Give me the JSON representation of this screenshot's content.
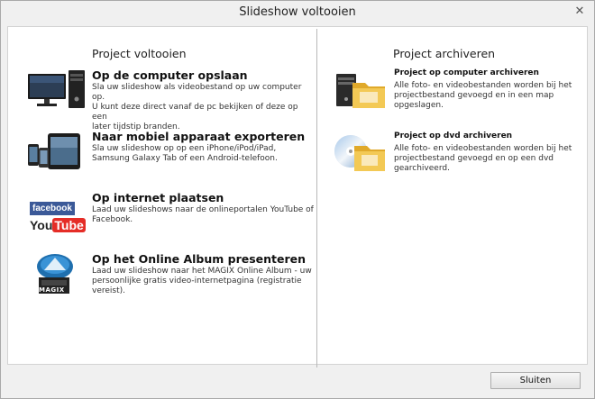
{
  "window": {
    "title": "Slideshow voltooien",
    "close_glyph": "✕"
  },
  "left": {
    "heading": "Project voltooien",
    "items": [
      {
        "icon": "computer-icon",
        "title": "Op de computer opslaan",
        "lines": [
          "Sla uw slideshow als videobestand op uw computer op.",
          "U kunt deze direct vanaf de pc bekijken of deze op een",
          "later tijdstip branden."
        ]
      },
      {
        "icon": "mobile-devices-icon",
        "title": "Naar mobiel apparaat exporteren",
        "lines": [
          "Sla uw slideshow op op een iPhone/iPod/iPad,",
          "Samsung Galaxy Tab of een Android-telefoon."
        ]
      },
      {
        "icon": "facebook-youtube-icon",
        "title": "Op internet plaatsen",
        "lines": [
          "Laad uw slideshows naar de onlineportalen YouTube of",
          "Facebook."
        ],
        "logo_facebook": "facebook",
        "logo_you": "You",
        "logo_tube": "Tube"
      },
      {
        "icon": "magix-album-icon",
        "title": "Op het Online Album presenteren",
        "lines": [
          "Laad uw slideshow naar het MAGIX Online Album - uw",
          "persoonlijke gratis video-internetpagina (registratie",
          "vereist)."
        ],
        "logo_magix": "MAGIX"
      }
    ]
  },
  "right": {
    "heading": "Project archiveren",
    "items": [
      {
        "icon": "computer-archive-icon",
        "title": "Project op computer archiveren",
        "lines": [
          "Alle foto- en videobestanden worden bij het",
          "projectbestand gevoegd en in een map",
          "opgeslagen."
        ]
      },
      {
        "icon": "dvd-archive-icon",
        "title": "Project op dvd archiveren",
        "lines": [
          "Alle foto- en videobestanden worden bij het",
          "projectbestand gevoegd en op een dvd",
          "gearchiveerd."
        ]
      }
    ]
  },
  "footer": {
    "close_label": "Sluiten"
  },
  "colors": {
    "facebook": "#3b5998",
    "youtube_red": "#e52d27",
    "folder": "#f0c14b"
  }
}
